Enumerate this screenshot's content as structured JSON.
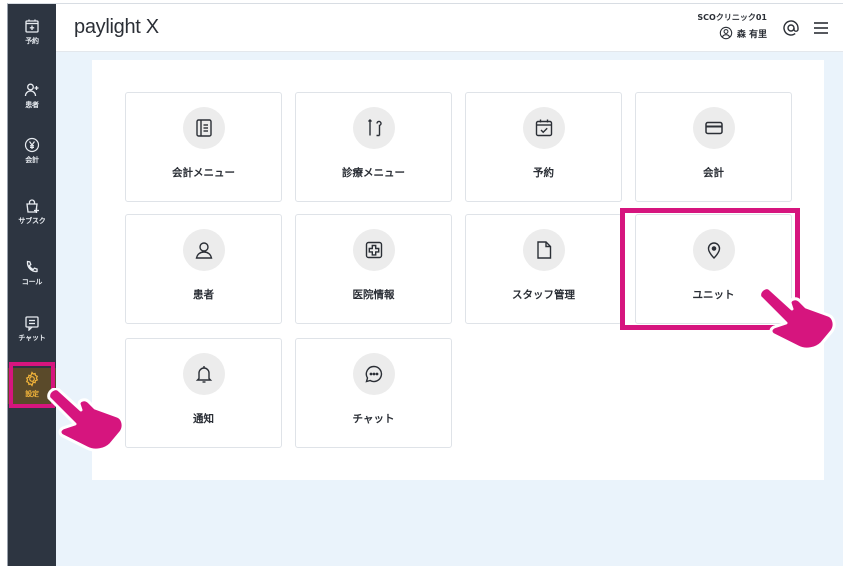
{
  "app": {
    "logo": "paylight X"
  },
  "header": {
    "clinic_name": "SCOクリニック01",
    "user_name": "森 有里",
    "icons": [
      "user-circle-icon",
      "at-icon",
      "menu-icon"
    ]
  },
  "sidebar": {
    "items": [
      {
        "label": "予約",
        "icon": "calendar-plus-icon"
      },
      {
        "label": "患者",
        "icon": "user-plus-icon"
      },
      {
        "label": "会計",
        "icon": "yen-icon"
      },
      {
        "label": "サブスク",
        "icon": "bag-plus-icon"
      },
      {
        "label": "コール",
        "icon": "phone-icon"
      },
      {
        "label": "チャット",
        "icon": "chat-icon"
      },
      {
        "label": "設定",
        "icon": "gear-icon"
      }
    ],
    "active": "設定"
  },
  "menu": {
    "cards": [
      {
        "label": "会計メニュー",
        "icon": "list-document-icon"
      },
      {
        "label": "診療メニュー",
        "icon": "dental-tools-icon"
      },
      {
        "label": "予約",
        "icon": "calendar-check-icon"
      },
      {
        "label": "会計",
        "icon": "credit-card-icon"
      },
      {
        "label": "患者",
        "icon": "user-icon"
      },
      {
        "label": "医院情報",
        "icon": "medical-cross-icon"
      },
      {
        "label": "スタッフ管理",
        "icon": "file-icon"
      },
      {
        "label": "ユニット",
        "icon": "location-pin-icon"
      },
      {
        "label": "通知",
        "icon": "bell-icon"
      },
      {
        "label": "チャット",
        "icon": "chat-bubble-icon"
      }
    ]
  },
  "annotation": {
    "highlight_color": "#d6157e"
  }
}
